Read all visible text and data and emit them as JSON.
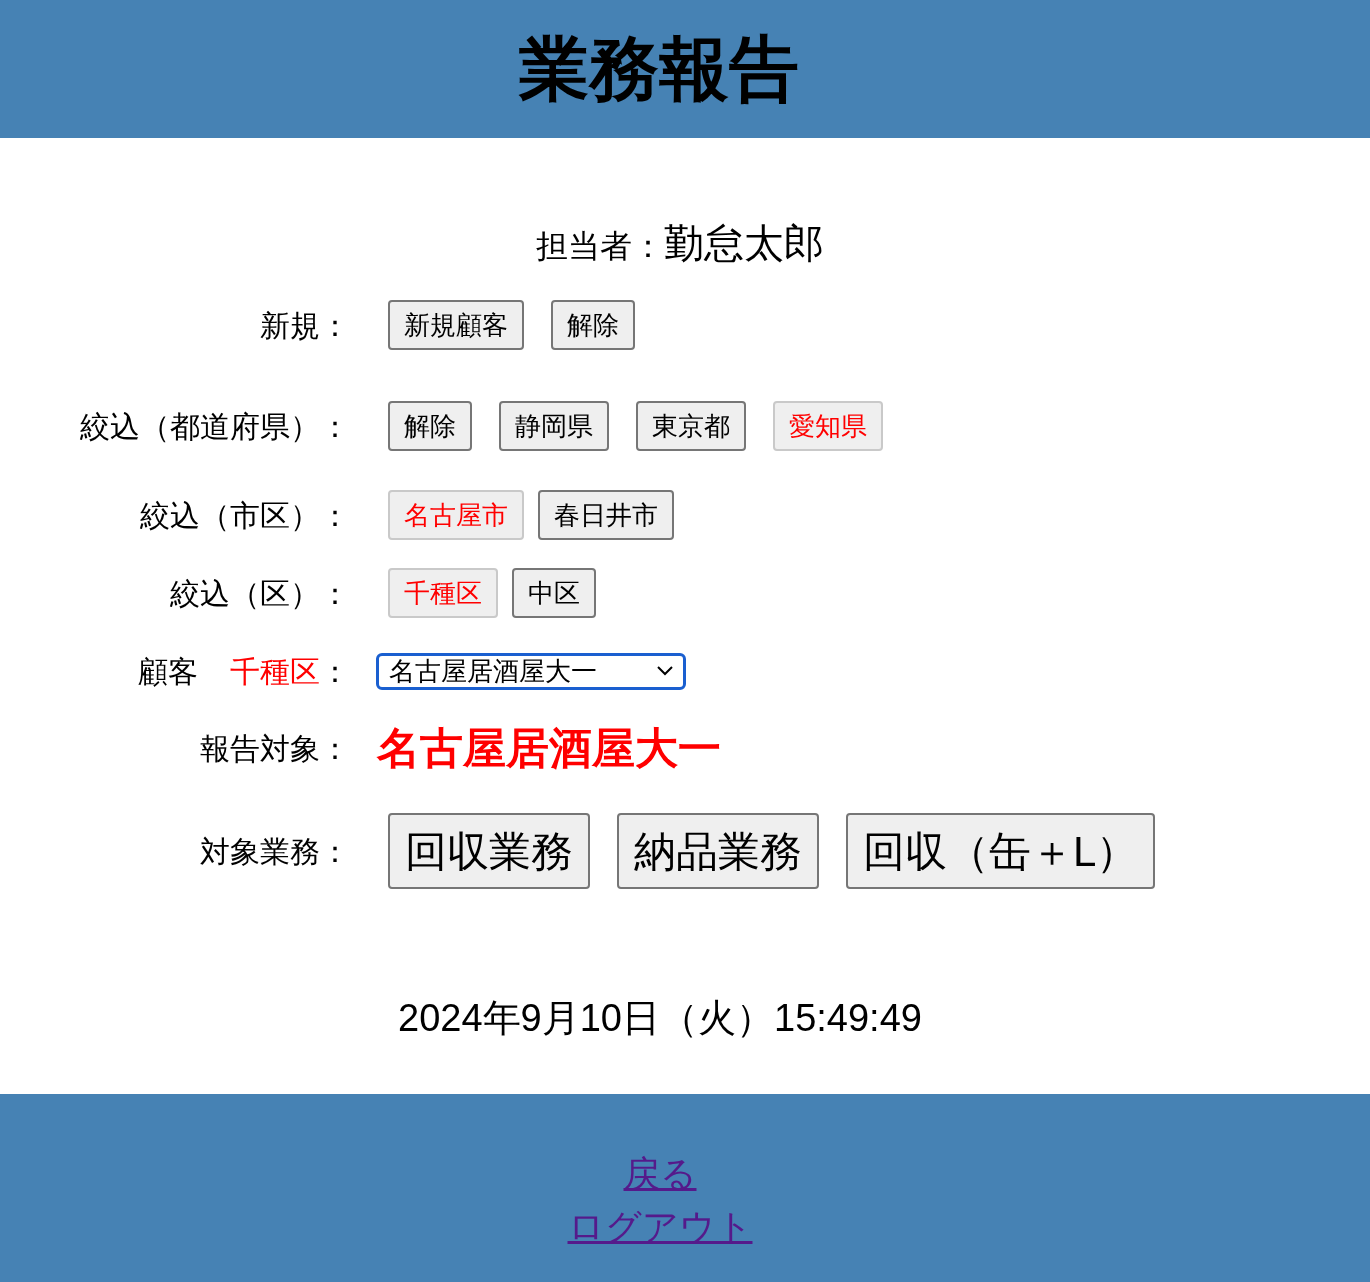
{
  "header": {
    "title": "業務報告"
  },
  "staff": {
    "label": "担当者：",
    "name": "勤怠太郎"
  },
  "new_customer": {
    "label": "新規：",
    "buttons": [
      {
        "label": "新規顧客"
      },
      {
        "label": "解除"
      }
    ]
  },
  "prefecture_filter": {
    "label": "絞込（都道府県）：",
    "buttons": [
      {
        "label": "解除",
        "selected": false
      },
      {
        "label": "静岡県",
        "selected": false
      },
      {
        "label": "東京都",
        "selected": false
      },
      {
        "label": "愛知県",
        "selected": true
      }
    ]
  },
  "city_filter": {
    "label": "絞込（市区）：",
    "buttons": [
      {
        "label": "名古屋市",
        "selected": true
      },
      {
        "label": "春日井市",
        "selected": false
      }
    ]
  },
  "ward_filter": {
    "label": "絞込（区）：",
    "buttons": [
      {
        "label": "千種区",
        "selected": true
      },
      {
        "label": "中区",
        "selected": false
      }
    ]
  },
  "customer": {
    "label": "顧客",
    "area": "千種区",
    "suffix": "：",
    "select": {
      "value": "名古屋居酒屋大一",
      "focused": true
    }
  },
  "report_target": {
    "label": "報告対象：",
    "value": "名古屋居酒屋大一"
  },
  "work": {
    "label": "対象業務：",
    "buttons": [
      {
        "label": "回収業務"
      },
      {
        "label": "納品業務"
      },
      {
        "label": "回収（缶＋L）"
      }
    ]
  },
  "datetime": "2024年9月10日（火）15:49:49",
  "footer": {
    "links": [
      {
        "label": "戻る",
        "visited": true
      },
      {
        "label": "ログアウト",
        "visited": true
      }
    ]
  }
}
